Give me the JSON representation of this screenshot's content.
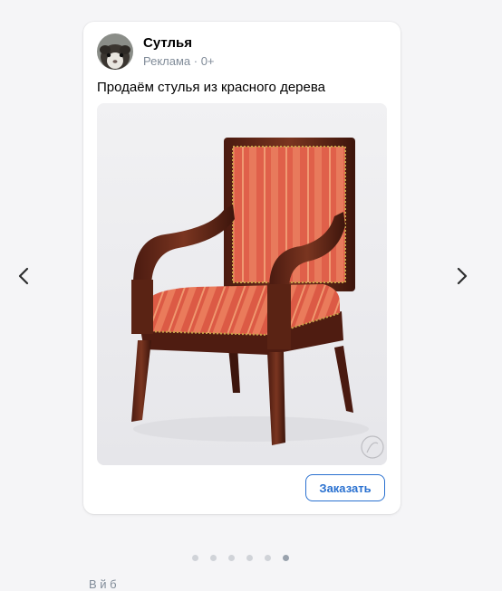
{
  "ad": {
    "brand_name": "Сутлья",
    "meta": "Реклама · 0+",
    "text": "Продаём стулья из красного дерева",
    "cta_label": "Заказать",
    "image_icon": "chair-photo"
  },
  "carousel": {
    "prev_icon": "chevron-left-icon",
    "next_icon": "chevron-right-icon",
    "dots_total": 6,
    "active_dot": 6
  },
  "footer": {
    "partial_text": "В       й          б"
  },
  "colors": {
    "accent": "#2a71d0",
    "meta_gray": "#818c99",
    "background": "#f5f5f7",
    "upholstery": "#e2604a",
    "wood": "#5a2314"
  }
}
